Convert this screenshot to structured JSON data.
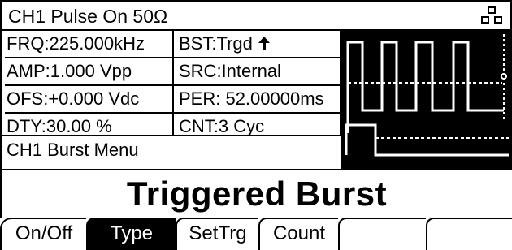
{
  "header": {
    "title": "CH1   Pulse On 50Ω",
    "sync_icon": "channel-coupling-icon"
  },
  "params": {
    "frequency": "FRQ:225.000kHz",
    "amplitude": "AMP:1.000 Vpp",
    "offset": "OFS:+0.000 Vdc",
    "duty": "DTY:30.00 %",
    "burst_type": "BST:Trgd",
    "burst_arrow_icon": "rising-edge-arrow-icon",
    "source": "SRC:Internal",
    "period": "PER: 52.00000ms",
    "count": "CNT:3 Cyc"
  },
  "menu": {
    "label": "CH1 Burst Menu"
  },
  "mode": {
    "title": "Triggered Burst"
  },
  "softkeys": [
    {
      "label": "On/Off",
      "active": false
    },
    {
      "label": "Type",
      "active": true
    },
    {
      "label": "SetTrg",
      "active": false
    },
    {
      "label": "Count",
      "active": false
    },
    {
      "label": "",
      "active": false
    },
    {
      "label": "",
      "active": false
    }
  ],
  "colors": {
    "background": "#ffffff",
    "foreground": "#000000",
    "waveform_bg": "#000000",
    "waveform_line": "#ffffff"
  }
}
